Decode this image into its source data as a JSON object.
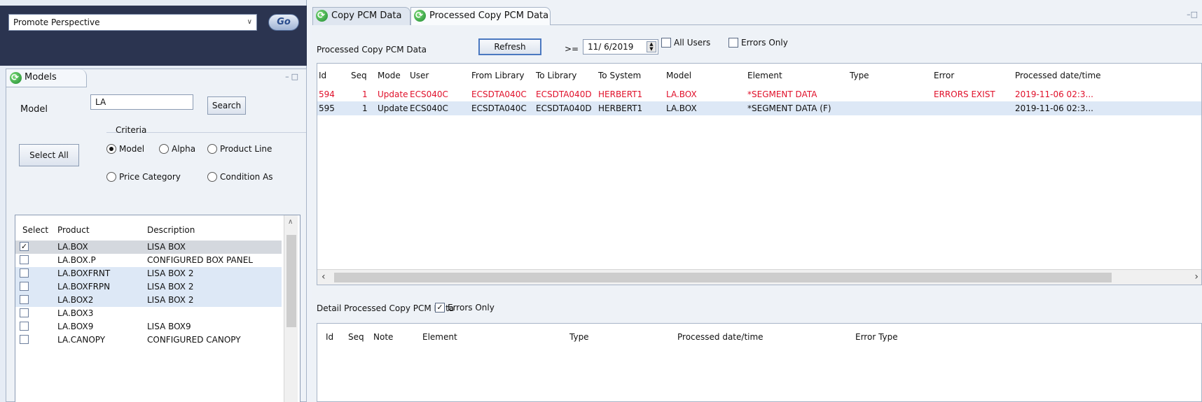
{
  "perspective": {
    "value": "Promote Perspective",
    "go_label": "Go"
  },
  "models": {
    "tab_label": "Models",
    "model_label": "Model",
    "model_value": "LA",
    "search_label": "Search",
    "criteria_label": "Criteria",
    "select_all_label": "Select All",
    "radios": [
      {
        "label": "Model",
        "selected": true
      },
      {
        "label": "Alpha",
        "selected": false
      },
      {
        "label": "Product Line",
        "selected": false
      },
      {
        "label": "Price Category",
        "selected": false
      },
      {
        "label": "Condition As",
        "selected": false
      }
    ],
    "columns": [
      "Select",
      "Product",
      "Description"
    ],
    "rows": [
      {
        "checked": true,
        "product": "LA.BOX",
        "description": "LISA BOX"
      },
      {
        "checked": false,
        "product": "LA.BOX.P",
        "description": "CONFIGURED BOX PANEL"
      },
      {
        "checked": false,
        "product": "LA.BOXFRNT",
        "description": "LISA BOX 2"
      },
      {
        "checked": false,
        "product": "LA.BOXFRPN",
        "description": "LISA BOX 2"
      },
      {
        "checked": false,
        "product": "LA.BOX2",
        "description": "LISA BOX 2"
      },
      {
        "checked": false,
        "product": "LA.BOX3",
        "description": ""
      },
      {
        "checked": false,
        "product": "LA.BOX9",
        "description": "LISA BOX9"
      },
      {
        "checked": false,
        "product": "LA.CANOPY",
        "description": "CONFIGURED CANOPY"
      }
    ]
  },
  "tabs": [
    {
      "label": "Copy PCM Data",
      "active": false
    },
    {
      "label": "Processed Copy PCM Data",
      "active": true
    }
  ],
  "toolbar": {
    "section_label": "Processed Copy PCM Data",
    "refresh_label": "Refresh",
    "gte_label": ">=",
    "date_value": "11/ 6/2019",
    "all_users_label": "All Users",
    "all_users_checked": false,
    "errors_only_label": "Errors Only",
    "errors_only_checked": false
  },
  "main_table": {
    "columns": [
      "Id",
      "Seq",
      "Mode",
      "User",
      "From Library",
      "To Library",
      "To System",
      "Model",
      "Element",
      "Type",
      "Error",
      "Processed date/time"
    ],
    "rows": [
      {
        "error": true,
        "cells": [
          "594",
          "1",
          "Update",
          "ECS040C",
          "ECSDTA040C",
          "ECSDTA040D",
          "HERBERT1",
          "LA.BOX",
          "*SEGMENT DATA",
          "",
          "ERRORS EXIST",
          "2019-11-06 02:3..."
        ]
      },
      {
        "error": false,
        "cells": [
          "595",
          "1",
          "Update",
          "ECS040C",
          "ECSDTA040C",
          "ECSDTA040D",
          "HERBERT1",
          "LA.BOX",
          "*SEGMENT DATA (F)",
          "",
          "",
          "2019-11-06 02:3..."
        ]
      }
    ]
  },
  "detail": {
    "section_label": "Detail Processed Copy PCM Data",
    "errors_only_label": "Errors Only",
    "errors_only_checked": true,
    "columns": [
      "Id",
      "Seq",
      "Note",
      "Element",
      "Type",
      "Processed date/time",
      "Error Type"
    ]
  }
}
